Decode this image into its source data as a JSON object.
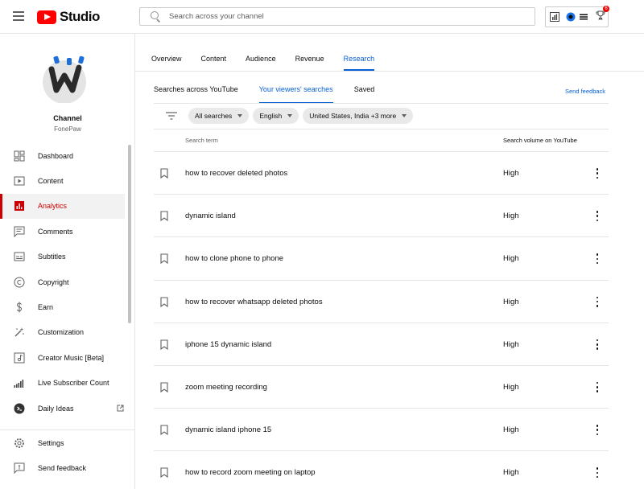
{
  "header": {
    "logo_text": "Studio",
    "search_placeholder": "Search across your channel",
    "notification_count": "6"
  },
  "channel": {
    "label": "Channel",
    "name": "FonePaw"
  },
  "sidebar": {
    "items": [
      {
        "label": "Dashboard",
        "icon": "dashboard-icon"
      },
      {
        "label": "Content",
        "icon": "content-icon"
      },
      {
        "label": "Analytics",
        "icon": "analytics-icon",
        "active": true
      },
      {
        "label": "Comments",
        "icon": "comments-icon"
      },
      {
        "label": "Subtitles",
        "icon": "subtitles-icon"
      },
      {
        "label": "Copyright",
        "icon": "copyright-icon"
      },
      {
        "label": "Earn",
        "icon": "earn-icon"
      },
      {
        "label": "Customization",
        "icon": "customization-icon"
      },
      {
        "label": "Creator Music [Beta]",
        "icon": "creator-music-icon"
      },
      {
        "label": "Live Subscriber Count",
        "icon": "live-subscriber-icon"
      },
      {
        "label": "Daily Ideas",
        "icon": "daily-ideas-icon"
      }
    ],
    "bottom": [
      {
        "label": "Settings",
        "icon": "settings-icon"
      },
      {
        "label": "Send feedback",
        "icon": "feedback-icon"
      }
    ]
  },
  "tabs": [
    "Overview",
    "Content",
    "Audience",
    "Revenue",
    "Research"
  ],
  "active_tab": "Research",
  "subtabs": [
    "Searches across YouTube",
    "Your viewers' searches",
    "Saved"
  ],
  "active_subtab": "Your viewers' searches",
  "send_feedback": "Send feedback",
  "filters": [
    "All searches",
    "English",
    "United States, India +3 more"
  ],
  "table": {
    "headers": {
      "term": "Search term",
      "volume": "Search volume on YouTube"
    },
    "rows": [
      {
        "term": "how to recover deleted photos",
        "volume": "High"
      },
      {
        "term": "dynamic island",
        "volume": "High"
      },
      {
        "term": "how to clone phone to phone",
        "volume": "High"
      },
      {
        "term": "how to recover whatsapp deleted photos",
        "volume": "High"
      },
      {
        "term": "iphone 15 dynamic island",
        "volume": "High"
      },
      {
        "term": "zoom meeting recording",
        "volume": "High"
      },
      {
        "term": "dynamic island iphone 15",
        "volume": "High"
      },
      {
        "term": "how to record zoom meeting on laptop",
        "volume": "High"
      }
    ]
  },
  "colors": {
    "accent_blue": "#065fd4",
    "active_red": "#cc0000",
    "youtube_red": "#ff0000"
  }
}
